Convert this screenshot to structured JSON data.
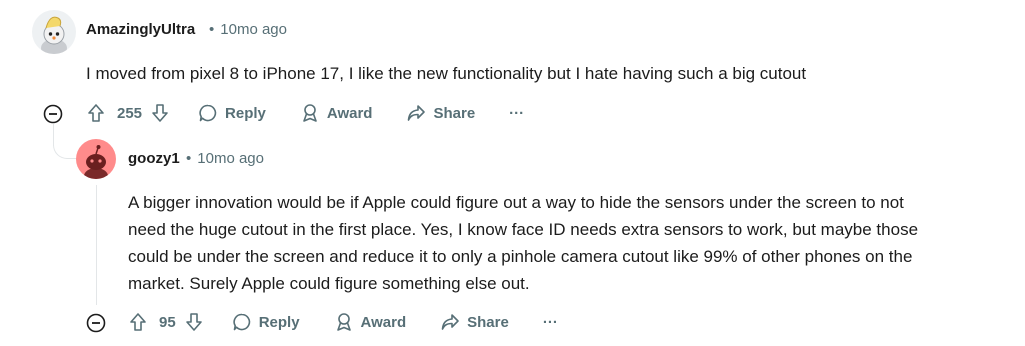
{
  "comments": [
    {
      "author": "AmazinglyUltra",
      "time": "10mo ago",
      "body": "I moved from pixel 8 to iPhone 17, I like the new functionality but I hate having such a big cutout",
      "votes": "255",
      "reply_label": "Reply",
      "award_label": "Award",
      "share_label": "Share",
      "more_label": "···"
    },
    {
      "author": "goozy1",
      "time": "10mo ago",
      "body_lines": [
        "A bigger innovation would be if Apple could figure out a way to hide the sensors under the screen to not",
        "need the huge cutout in the first place. Yes, I know face ID needs extra sensors to work, but maybe those",
        "could be under the screen and reduce it to only a pinhole camera cutout like 99% of other phones on the",
        "market. Surely Apple could figure something else out."
      ],
      "votes": "95",
      "reply_label": "Reply",
      "award_label": "Award",
      "share_label": "Share",
      "more_label": "···"
    }
  ],
  "separator": "•"
}
